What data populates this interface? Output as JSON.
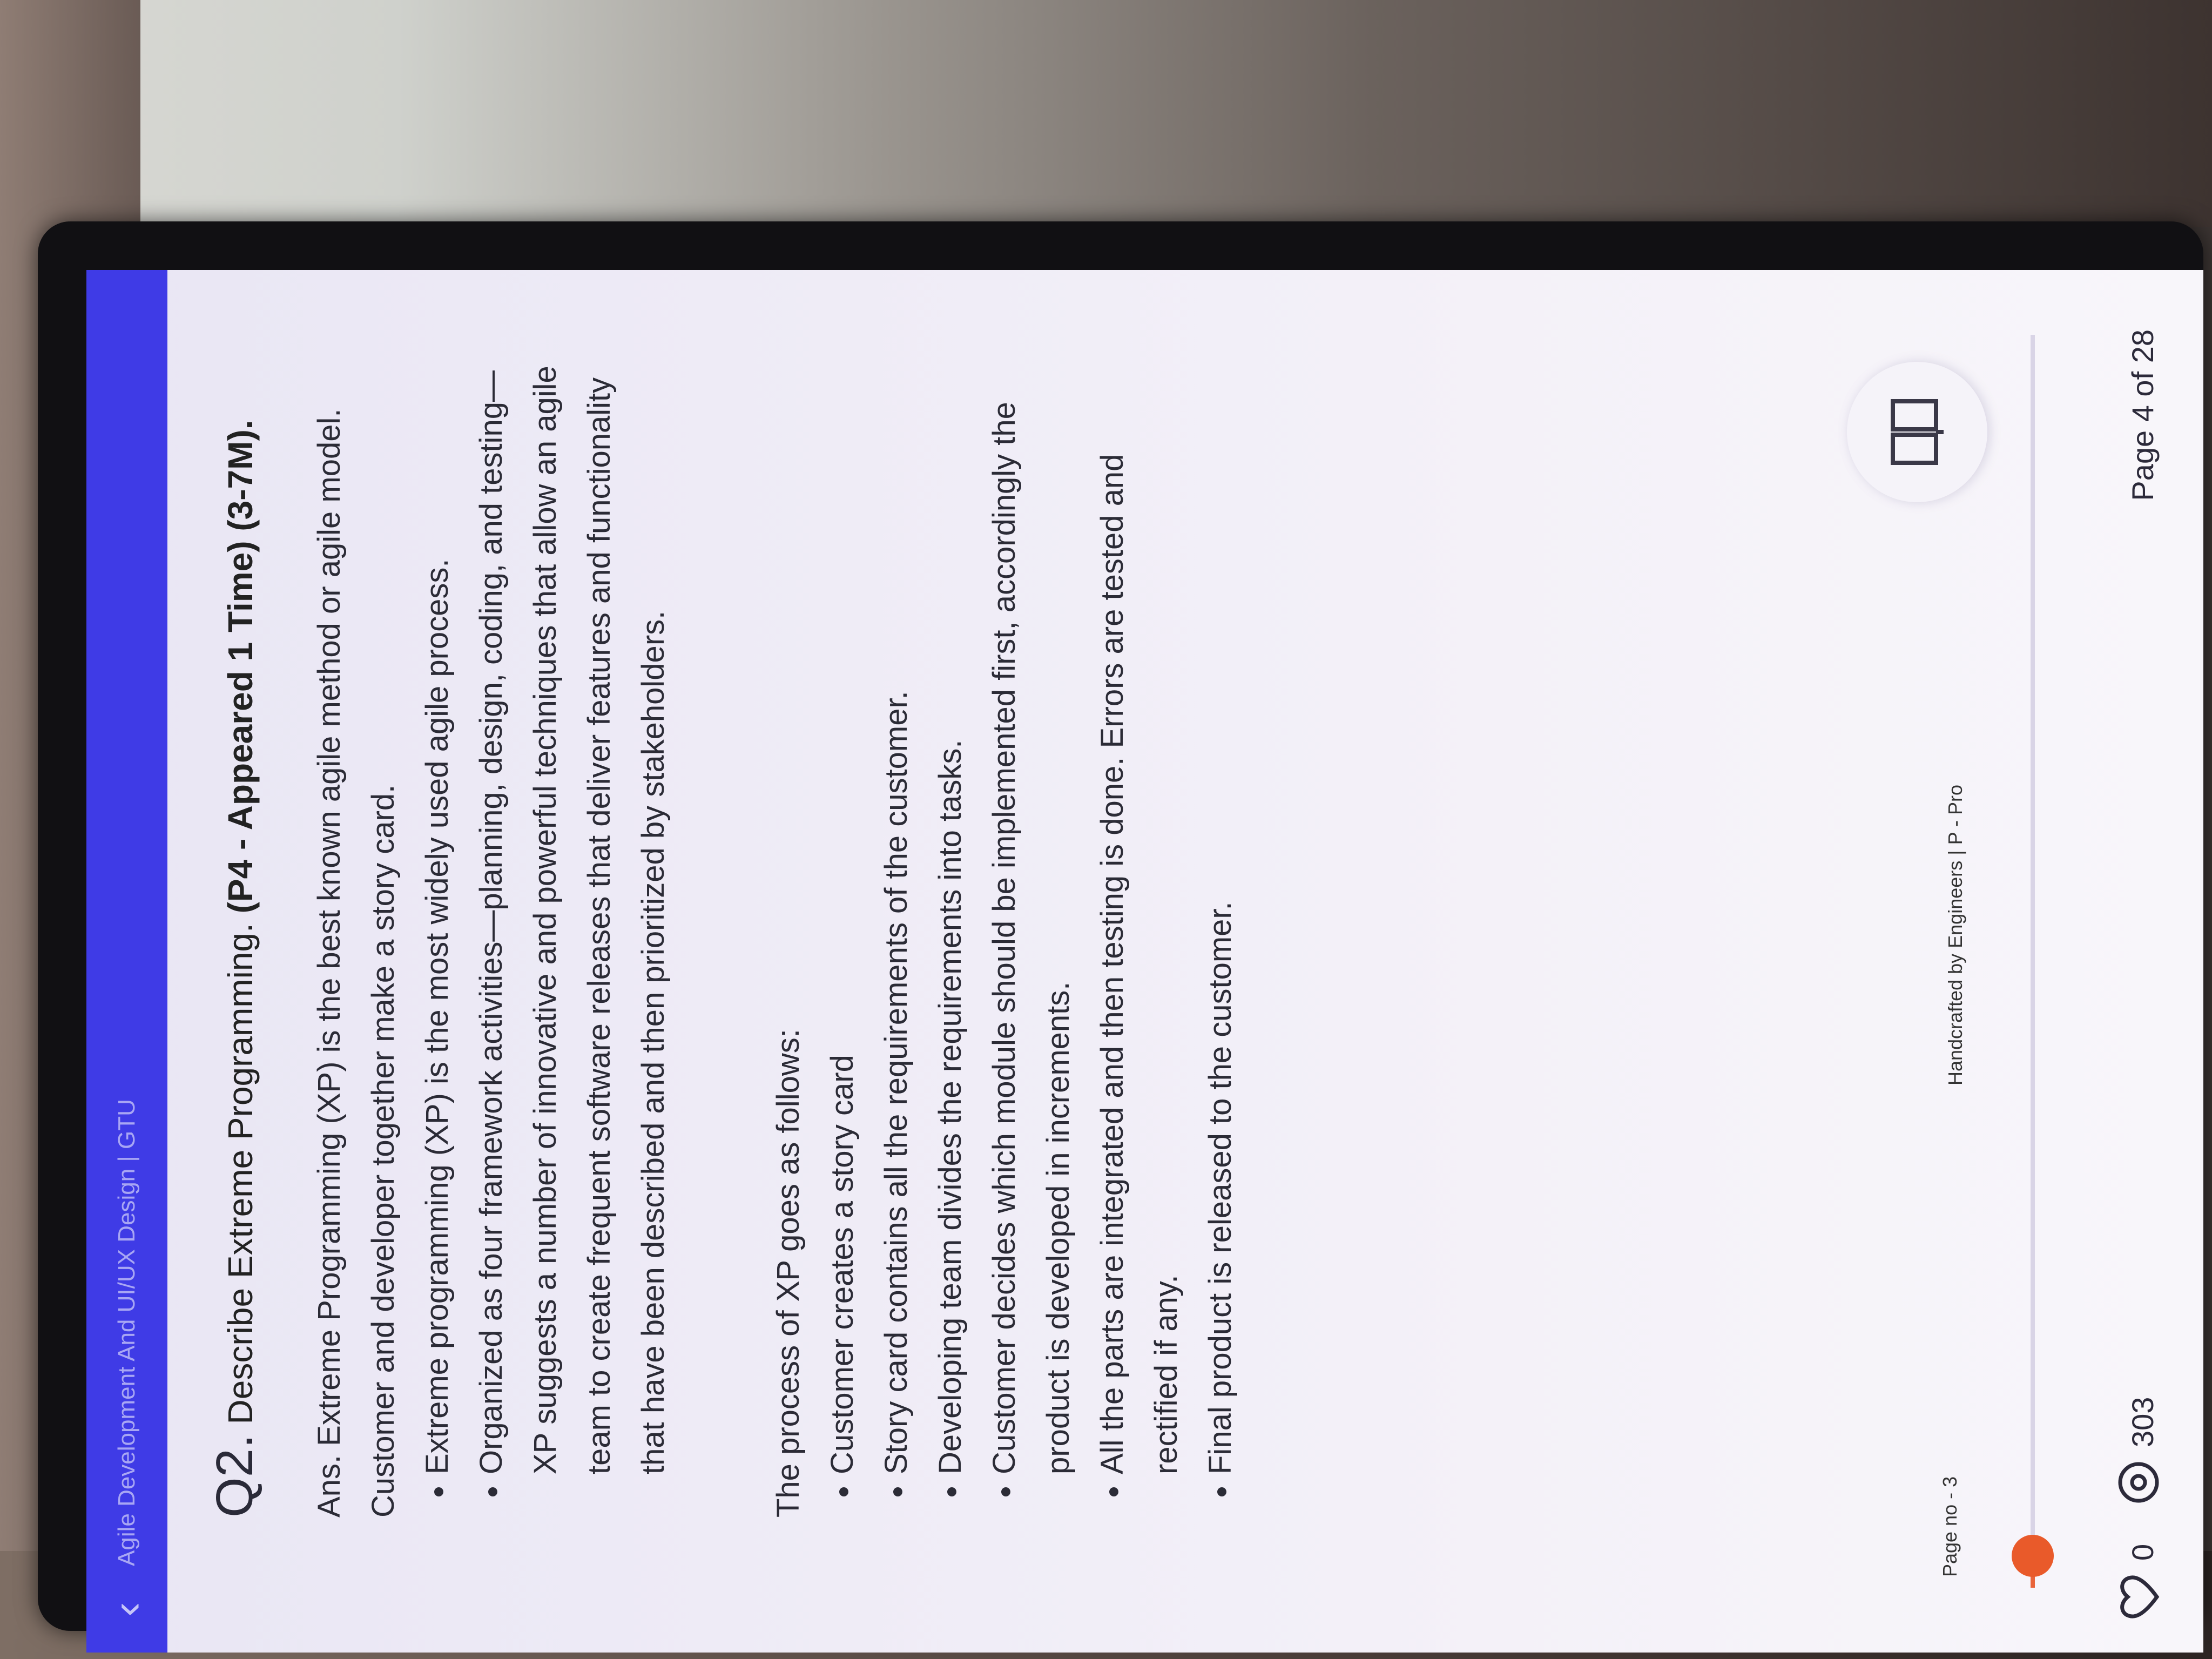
{
  "app": {
    "title": "Agile Development And UI/UX Design | GTU"
  },
  "document": {
    "question_number": "Q2.",
    "question_text": "Describe Extreme Programming.",
    "question_meta": "(P4 - Appeared 1 Time) (3-7M).",
    "answer_intro": "Ans. Extreme Programming (XP) is the best known agile method or agile model. Customer and developer together make a story card.",
    "bullets_1": [
      "Extreme programming (XP) is the most widely used agile process.",
      "Organized as four framework activities—planning, design, coding, and testing—XP suggests a number of innovative and powerful techniques that allow an agile team to create frequent software releases that deliver features and functionality that have been described and then prioritized by stakeholders."
    ],
    "process_title": "The process of XP goes as follows:",
    "bullets_2": [
      "Customer creates a story card",
      "Story card contains all the requirements of the customer.",
      "Developing team divides the requirements into tasks.",
      "Customer decides which module should be implemented first, accordingly the product is developed in increments.",
      "All the parts are integrated and then testing is done. Errors are tested and rectified if any.",
      "Final product is released to the customer."
    ],
    "page_no": "Page no - 3",
    "credit": "Handcrafted by Engineers | P - Pro"
  },
  "reader": {
    "likes": "0",
    "views": "303",
    "page_indicator": "Page 4 of 28",
    "progress_fraction": 0.04,
    "accent_color": "#e95a2a",
    "topbar_color": "#3f3be6",
    "icons": [
      "back-arrow-icon",
      "book-icon",
      "heart-icon",
      "eye-icon"
    ]
  }
}
